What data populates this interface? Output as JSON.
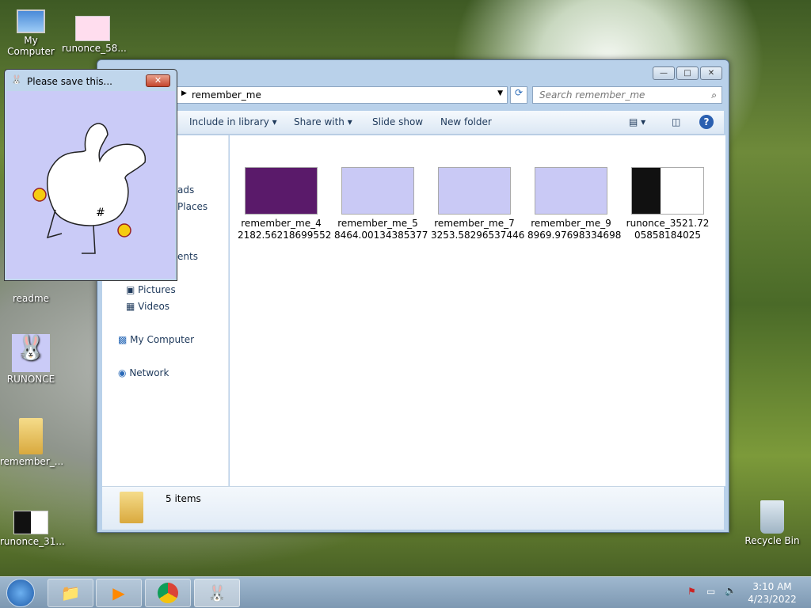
{
  "desktop": {
    "icons": [
      "My Computer",
      "runonce_58...",
      "readme",
      "RUNONCE",
      "remember_...",
      "runonce_31...",
      "Recycle Bin"
    ]
  },
  "explorer": {
    "address": "remember_me",
    "search_placeholder": "Search remember_me",
    "toolbar": {
      "include": "Include in library",
      "share": "Share with",
      "slideshow": "Slide show",
      "newfolder": "New folder"
    },
    "nav": [
      "ads",
      "Places",
      "ents",
      "Pictures",
      "Videos",
      "My Computer",
      "Network"
    ],
    "files": [
      {
        "l1": "remember_me_4",
        "l2": "2182.56218699552",
        "bg": "#5a1a6a"
      },
      {
        "l1": "remember_me_5",
        "l2": "8464.00134385377",
        "bg": "#c9c9f5"
      },
      {
        "l1": "remember_me_7",
        "l2": "3253.58296537446",
        "bg": "#c9c9f5"
      },
      {
        "l1": "remember_me_9",
        "l2": "8969.97698334698",
        "bg": "#c9c9f5"
      },
      {
        "l1": "runonce_3521.72",
        "l2": "05858184025",
        "bg": "#111111"
      }
    ],
    "status": "5 items"
  },
  "popup": {
    "title": "Please save this...",
    "bg": "#cacbf7"
  },
  "taskbar": {
    "time": "3:10 AM",
    "date": "4/23/2022"
  }
}
